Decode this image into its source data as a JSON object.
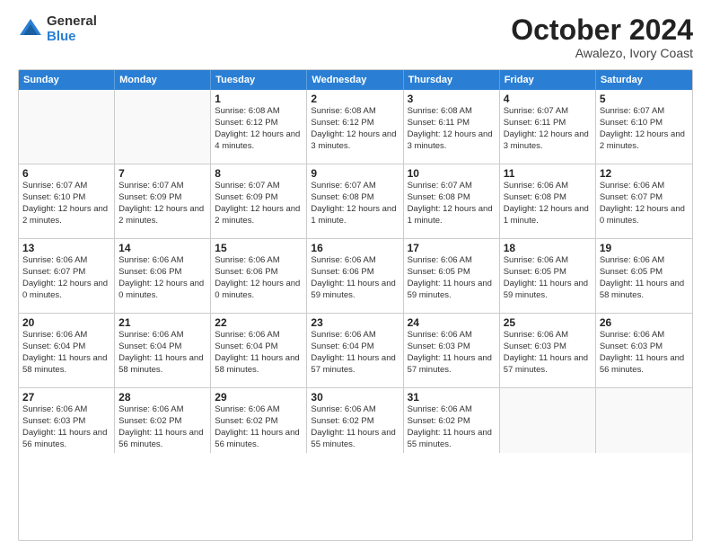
{
  "logo": {
    "general": "General",
    "blue": "Blue"
  },
  "title": "October 2024",
  "subtitle": "Awalezo, Ivory Coast",
  "days": [
    "Sunday",
    "Monday",
    "Tuesday",
    "Wednesday",
    "Thursday",
    "Friday",
    "Saturday"
  ],
  "weeks": [
    [
      {
        "day": "",
        "info": ""
      },
      {
        "day": "",
        "info": ""
      },
      {
        "day": "1",
        "info": "Sunrise: 6:08 AM\nSunset: 6:12 PM\nDaylight: 12 hours and 4 minutes."
      },
      {
        "day": "2",
        "info": "Sunrise: 6:08 AM\nSunset: 6:12 PM\nDaylight: 12 hours and 3 minutes."
      },
      {
        "day": "3",
        "info": "Sunrise: 6:08 AM\nSunset: 6:11 PM\nDaylight: 12 hours and 3 minutes."
      },
      {
        "day": "4",
        "info": "Sunrise: 6:07 AM\nSunset: 6:11 PM\nDaylight: 12 hours and 3 minutes."
      },
      {
        "day": "5",
        "info": "Sunrise: 6:07 AM\nSunset: 6:10 PM\nDaylight: 12 hours and 2 minutes."
      }
    ],
    [
      {
        "day": "6",
        "info": "Sunrise: 6:07 AM\nSunset: 6:10 PM\nDaylight: 12 hours and 2 minutes."
      },
      {
        "day": "7",
        "info": "Sunrise: 6:07 AM\nSunset: 6:09 PM\nDaylight: 12 hours and 2 minutes."
      },
      {
        "day": "8",
        "info": "Sunrise: 6:07 AM\nSunset: 6:09 PM\nDaylight: 12 hours and 2 minutes."
      },
      {
        "day": "9",
        "info": "Sunrise: 6:07 AM\nSunset: 6:08 PM\nDaylight: 12 hours and 1 minute."
      },
      {
        "day": "10",
        "info": "Sunrise: 6:07 AM\nSunset: 6:08 PM\nDaylight: 12 hours and 1 minute."
      },
      {
        "day": "11",
        "info": "Sunrise: 6:06 AM\nSunset: 6:08 PM\nDaylight: 12 hours and 1 minute."
      },
      {
        "day": "12",
        "info": "Sunrise: 6:06 AM\nSunset: 6:07 PM\nDaylight: 12 hours and 0 minutes."
      }
    ],
    [
      {
        "day": "13",
        "info": "Sunrise: 6:06 AM\nSunset: 6:07 PM\nDaylight: 12 hours and 0 minutes."
      },
      {
        "day": "14",
        "info": "Sunrise: 6:06 AM\nSunset: 6:06 PM\nDaylight: 12 hours and 0 minutes."
      },
      {
        "day": "15",
        "info": "Sunrise: 6:06 AM\nSunset: 6:06 PM\nDaylight: 12 hours and 0 minutes."
      },
      {
        "day": "16",
        "info": "Sunrise: 6:06 AM\nSunset: 6:06 PM\nDaylight: 11 hours and 59 minutes."
      },
      {
        "day": "17",
        "info": "Sunrise: 6:06 AM\nSunset: 6:05 PM\nDaylight: 11 hours and 59 minutes."
      },
      {
        "day": "18",
        "info": "Sunrise: 6:06 AM\nSunset: 6:05 PM\nDaylight: 11 hours and 59 minutes."
      },
      {
        "day": "19",
        "info": "Sunrise: 6:06 AM\nSunset: 6:05 PM\nDaylight: 11 hours and 58 minutes."
      }
    ],
    [
      {
        "day": "20",
        "info": "Sunrise: 6:06 AM\nSunset: 6:04 PM\nDaylight: 11 hours and 58 minutes."
      },
      {
        "day": "21",
        "info": "Sunrise: 6:06 AM\nSunset: 6:04 PM\nDaylight: 11 hours and 58 minutes."
      },
      {
        "day": "22",
        "info": "Sunrise: 6:06 AM\nSunset: 6:04 PM\nDaylight: 11 hours and 58 minutes."
      },
      {
        "day": "23",
        "info": "Sunrise: 6:06 AM\nSunset: 6:04 PM\nDaylight: 11 hours and 57 minutes."
      },
      {
        "day": "24",
        "info": "Sunrise: 6:06 AM\nSunset: 6:03 PM\nDaylight: 11 hours and 57 minutes."
      },
      {
        "day": "25",
        "info": "Sunrise: 6:06 AM\nSunset: 6:03 PM\nDaylight: 11 hours and 57 minutes."
      },
      {
        "day": "26",
        "info": "Sunrise: 6:06 AM\nSunset: 6:03 PM\nDaylight: 11 hours and 56 minutes."
      }
    ],
    [
      {
        "day": "27",
        "info": "Sunrise: 6:06 AM\nSunset: 6:03 PM\nDaylight: 11 hours and 56 minutes."
      },
      {
        "day": "28",
        "info": "Sunrise: 6:06 AM\nSunset: 6:02 PM\nDaylight: 11 hours and 56 minutes."
      },
      {
        "day": "29",
        "info": "Sunrise: 6:06 AM\nSunset: 6:02 PM\nDaylight: 11 hours and 56 minutes."
      },
      {
        "day": "30",
        "info": "Sunrise: 6:06 AM\nSunset: 6:02 PM\nDaylight: 11 hours and 55 minutes."
      },
      {
        "day": "31",
        "info": "Sunrise: 6:06 AM\nSunset: 6:02 PM\nDaylight: 11 hours and 55 minutes."
      },
      {
        "day": "",
        "info": ""
      },
      {
        "day": "",
        "info": ""
      }
    ]
  ]
}
